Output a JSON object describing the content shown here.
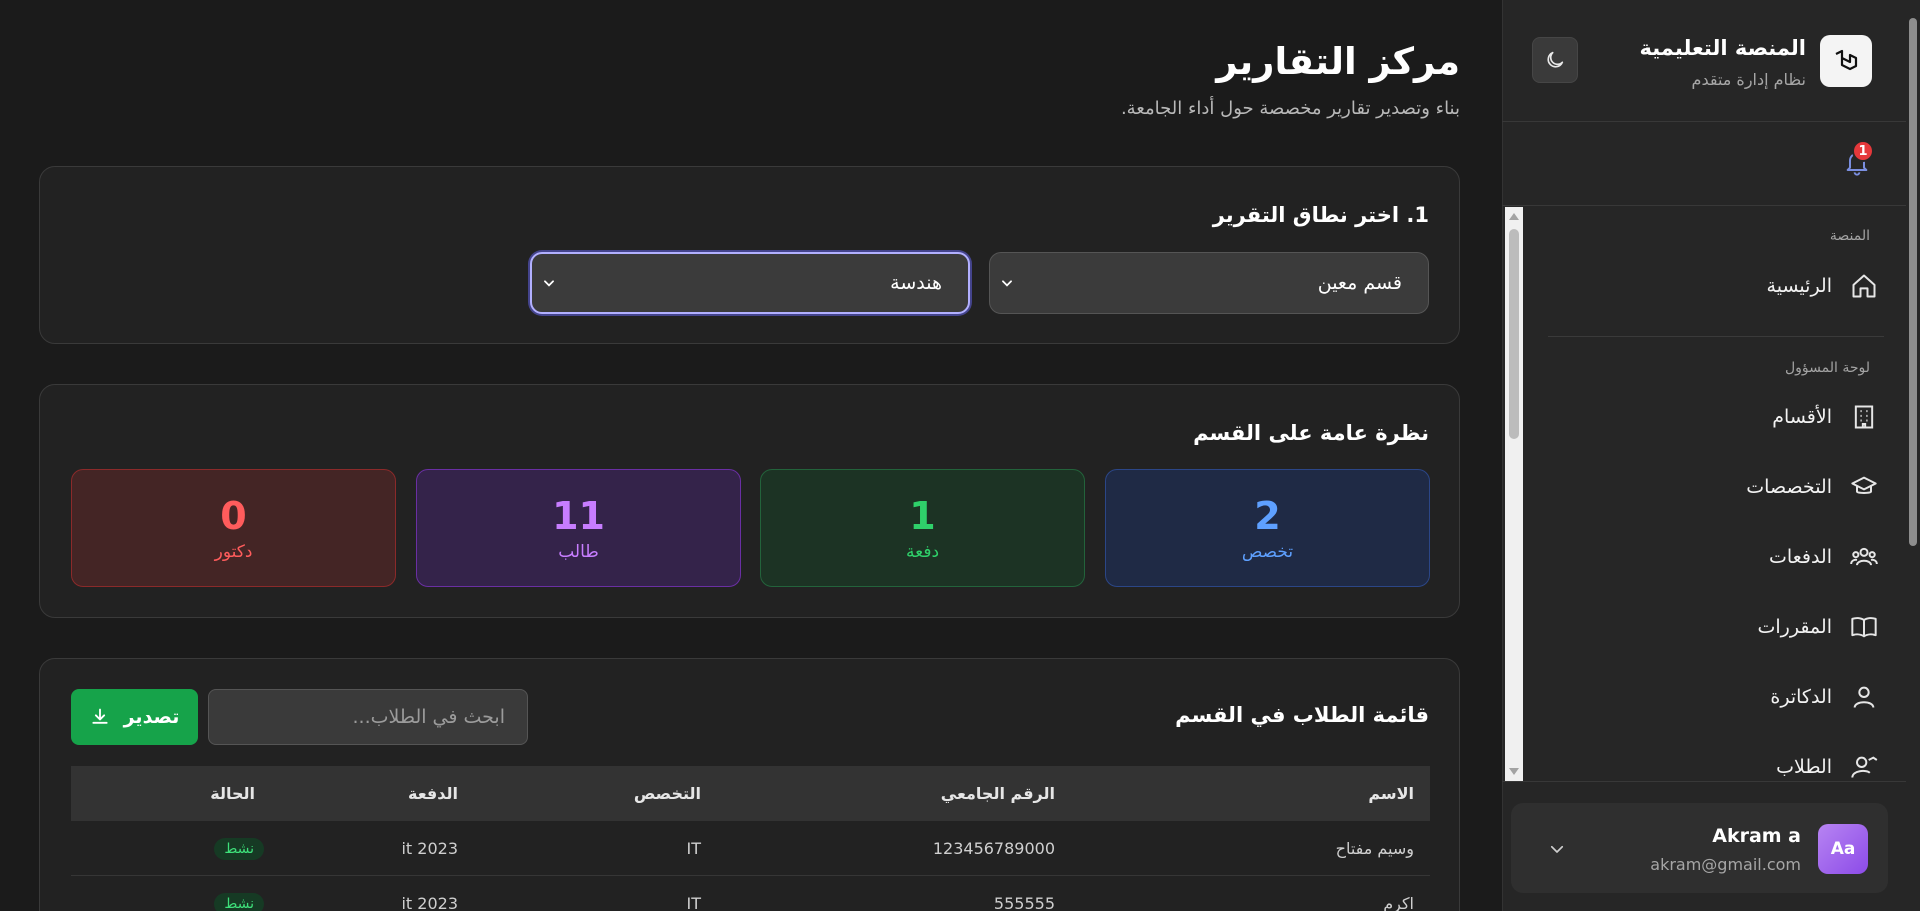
{
  "brand": {
    "title": "المنصة التعليمية",
    "subtitle": "نظام إدارة متقدم"
  },
  "notifications": {
    "count": "1"
  },
  "sidebar": {
    "sections": [
      {
        "label": "المنصة"
      },
      {
        "label": "لوحة المسؤول"
      }
    ],
    "items": [
      {
        "label": "الرئيسية",
        "icon": "home-icon"
      },
      {
        "label": "الأقسام",
        "icon": "building-icon"
      },
      {
        "label": "التخصصات",
        "icon": "graduation-cap-icon"
      },
      {
        "label": "الدفعات",
        "icon": "users-group-icon"
      },
      {
        "label": "المقررات",
        "icon": "book-icon"
      },
      {
        "label": "الدكاترة",
        "icon": "user-icon"
      },
      {
        "label": "الطلاب",
        "icon": "students-icon"
      }
    ]
  },
  "user": {
    "initials": "Aa",
    "name": "Akram a",
    "email": "akram@gmail.com"
  },
  "page": {
    "title": "مركز التقارير",
    "subtitle": "بناء وتصدير تقارير مخصصة حول أداء الجامعة."
  },
  "scope": {
    "title": "1. اختر نطاق التقرير",
    "scope_select": "قسم معين",
    "department_select": "هندسة"
  },
  "overview": {
    "title": "نظرة عامة على القسم",
    "stats": [
      {
        "value": "2",
        "label": "تخصص",
        "color": "#5ea0ff"
      },
      {
        "value": "1",
        "label": "دفعة",
        "color": "#2fd06a"
      },
      {
        "value": "11",
        "label": "طالب",
        "color": "#c77dff"
      },
      {
        "value": "0",
        "label": "دكتور",
        "color": "#ff5c5c"
      }
    ]
  },
  "students": {
    "title": "قائمة الطلاب في القسم",
    "search_placeholder": "ابحث في الطلاب...",
    "export_label": "تصدير",
    "columns": [
      "الاسم",
      "الرقم الجامعي",
      "التخصص",
      "الدفعة",
      "الحالة"
    ],
    "rows": [
      {
        "name": "وسيم مفتاح",
        "id": "123456789000",
        "major": "IT",
        "batch": "it 2023",
        "status": "نشط"
      },
      {
        "name": "اكرم",
        "id": "555555",
        "major": "IT",
        "batch": "it 2023",
        "status": "نشط"
      }
    ]
  },
  "colors": {
    "background": "#1b1b1b",
    "card": "#222222",
    "accent_green": "#16a34a",
    "badge_red": "#e5383b"
  }
}
